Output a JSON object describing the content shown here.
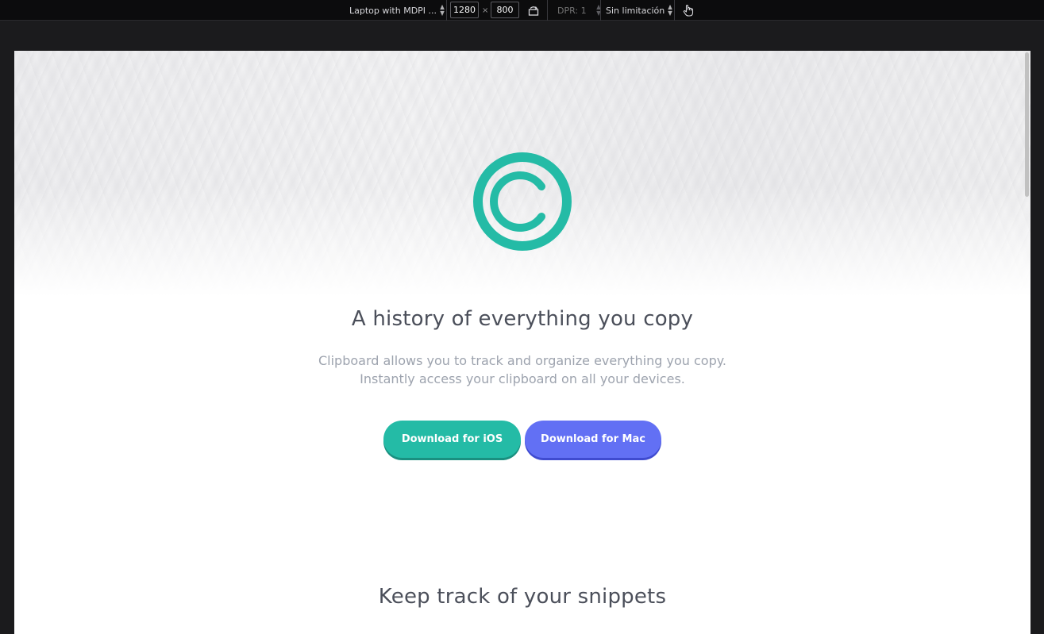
{
  "devtools": {
    "device_label": "Laptop with MDPI ...",
    "width": "1280",
    "height": "800",
    "times": "×",
    "dpr_label": "DPR: 1",
    "throttle_label": "Sin limitación"
  },
  "page": {
    "headline": "A history of everything you copy",
    "subtext_line1": "Clipboard allows you to track and organize everything you copy.",
    "subtext_line2": "Instantly access your clipboard on all your devices.",
    "ios_button": "Download for iOS",
    "mac_button": "Download for Mac",
    "section_title": "Keep track of your snippets"
  },
  "colors": {
    "accent_teal": "#24bba6",
    "accent_blue": "#6270f4",
    "heading": "#4b4f5a",
    "body_text": "#9da3ae"
  },
  "icons": {
    "logo": "clipboard-c-logo-icon",
    "rotate": "rotate-icon",
    "touch": "touch-hand-icon"
  }
}
